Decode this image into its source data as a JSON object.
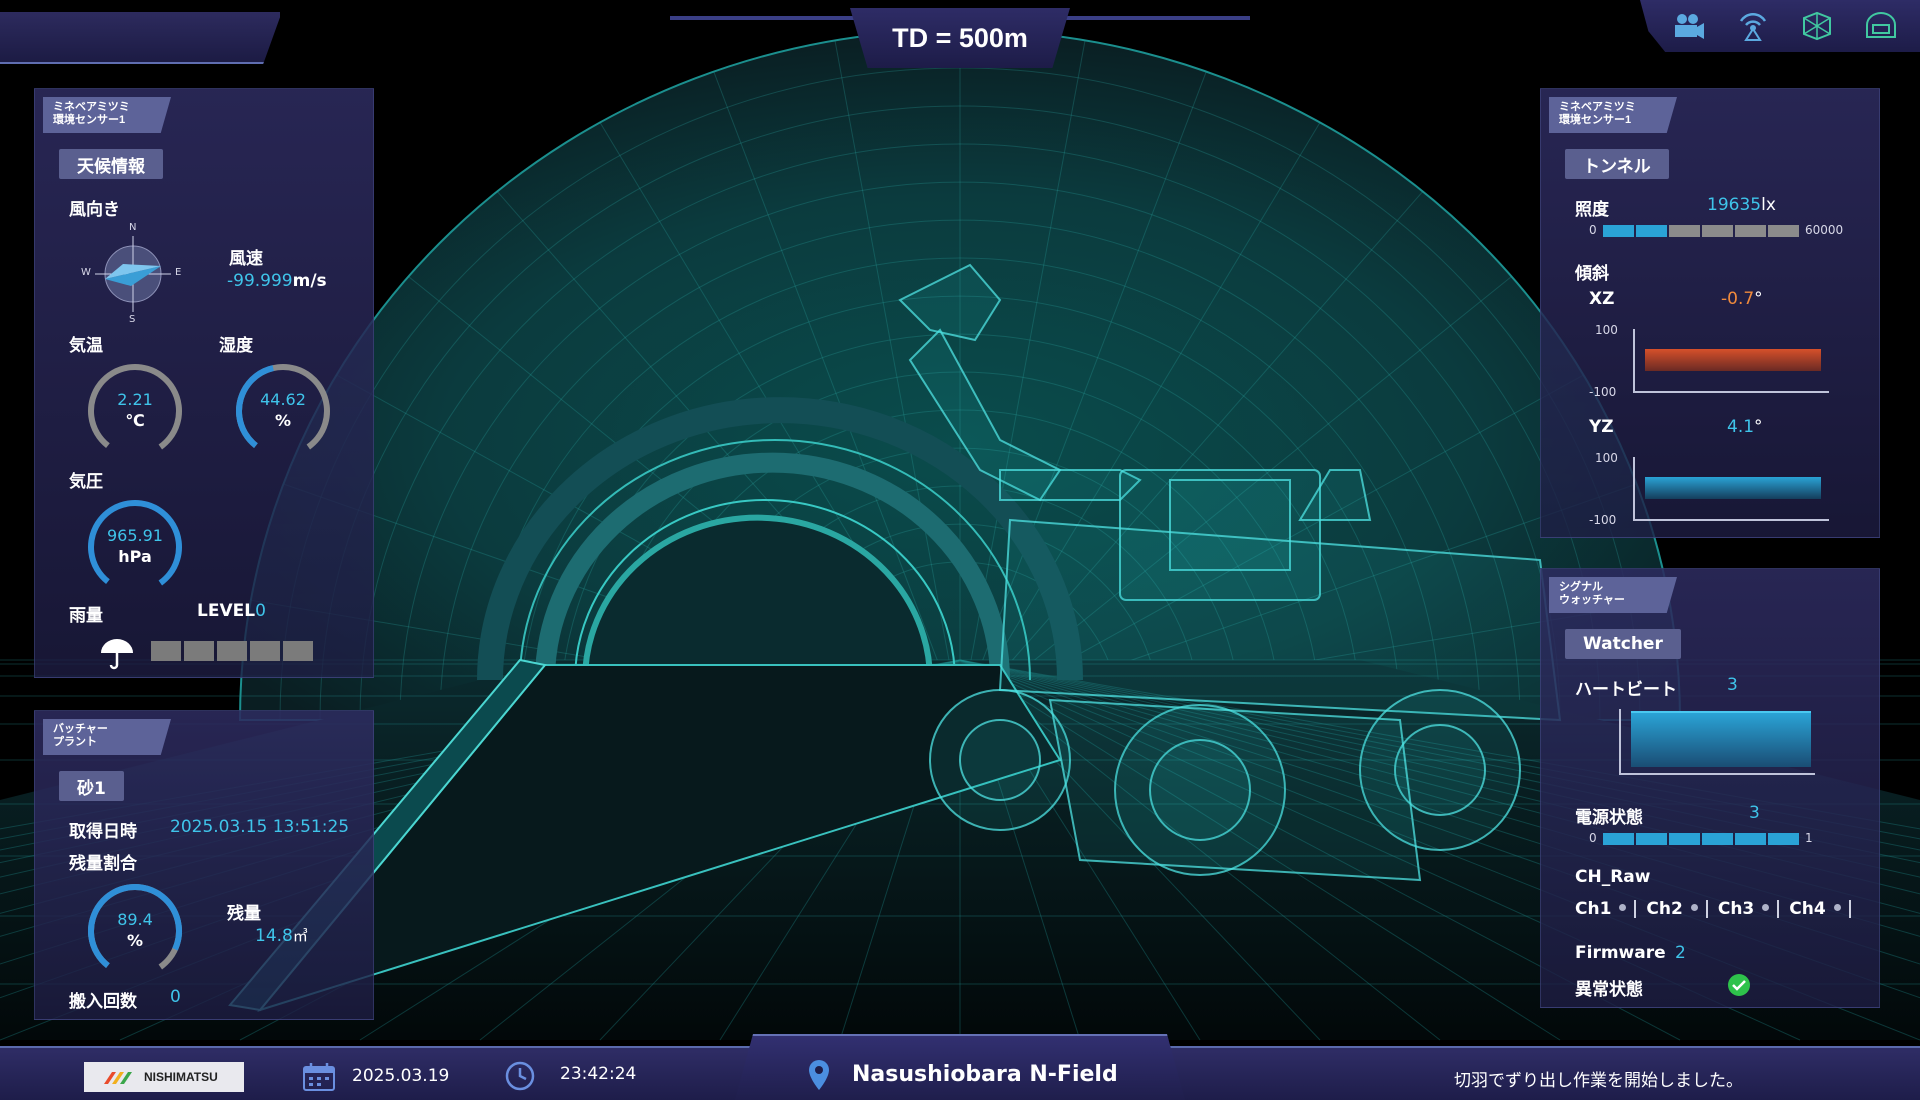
{
  "header": {
    "td_label": "TD = 500m",
    "icons": [
      "camera-icon",
      "signal-tower-icon",
      "3d-cube-icon",
      "vehicle-icon"
    ]
  },
  "weather_panel": {
    "tag": "ミネベアミツミ\n環境センサー1",
    "category": "天候情報",
    "wind_direction_label": "風向き",
    "compass": {
      "n": "N",
      "e": "E",
      "s": "S",
      "w": "W"
    },
    "wind_speed_label": "風速",
    "wind_speed_value": "-99.999",
    "wind_speed_unit": "m/s",
    "temperature_label": "気温",
    "temperature_value": "2.21",
    "temperature_unit": "℃",
    "humidity_label": "湿度",
    "humidity_value": "44.62",
    "humidity_unit": "%",
    "humidity_fraction": 0.45,
    "pressure_label": "気圧",
    "pressure_value": "965.91",
    "pressure_unit": "hPa",
    "rain_label": "雨量",
    "rain_level_label": "LEVEL",
    "rain_level_value": "0",
    "rain_segments": 5
  },
  "batcher_panel": {
    "tag": "バッチャー\nプラント",
    "material": "砂1",
    "acquired_label": "取得日時",
    "acquired_value": "2025.03.15 13:51:25",
    "remaining_ratio_label": "残量割合",
    "remaining_ratio_value": "89.4",
    "remaining_ratio_unit": "%",
    "remaining_ratio_fraction": 0.894,
    "remaining_label": "残量",
    "remaining_value": "14.8",
    "remaining_unit": "㎥",
    "delivery_count_label": "搬入回数",
    "delivery_count_value": "0"
  },
  "tunnel_panel": {
    "tag": "ミネベアミツミ\n環境センサー1",
    "category": "トンネル",
    "illuminance_label": "照度",
    "illuminance_value": "19635",
    "illuminance_unit": "lx",
    "illuminance_min": "0",
    "illuminance_max": "60000",
    "illuminance_fraction": 0.33,
    "tilt_label": "傾斜",
    "xz_label": "XZ",
    "xz_value": "-0.7",
    "xz_unit": "°",
    "yz_label": "YZ",
    "yz_value": "4.1",
    "yz_unit": "°",
    "axis_max": "100",
    "axis_min": "-100"
  },
  "signal_panel": {
    "tag": "シグナル\nウォッチャー",
    "category": "Watcher",
    "heartbeat_label": "ハートビート",
    "heartbeat_value": "3",
    "power_label": "電源状態",
    "power_value": "3",
    "power_min": "0",
    "power_max": "1",
    "ch_raw_label": "CH_Raw",
    "channels": [
      "Ch1",
      "Ch2",
      "Ch3",
      "Ch4"
    ],
    "firmware_label": "Firmware",
    "firmware_value": "2",
    "abnormal_label": "異常状態"
  },
  "footer": {
    "company": "NISHIMATSU",
    "date": "2025.03.19",
    "time": "23:42:24",
    "location": "Nasushiobara N-Field",
    "message": "切羽でずり出し作業を開始しました。"
  },
  "colors": {
    "accent": "#3fc4ea",
    "xz_color": "#f08a3c",
    "panel": "#2d2b5f",
    "ok_green": "#2ec24b"
  }
}
